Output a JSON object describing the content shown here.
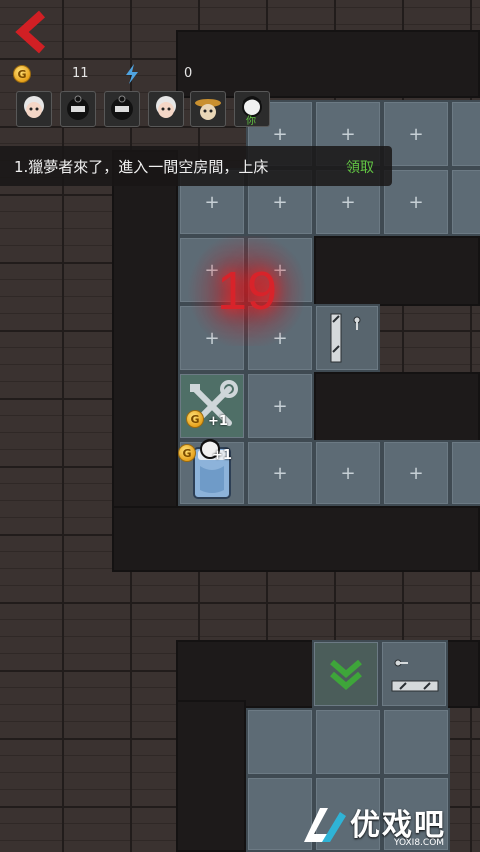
{
  "hud": {
    "back_icon": "chevron-left-icon",
    "coin_icon": "gold-coin-icon",
    "coin_letter": "G",
    "coins": "11",
    "energy_icon": "lightning-icon",
    "energy": "0",
    "accent_color": "#d11f24",
    "claim_color": "#62c443"
  },
  "hunters": [
    {
      "name": "hunter-granny-1",
      "icon": "granny-face-icon"
    },
    {
      "name": "hunter-masked-1",
      "icon": "masked-face-icon"
    },
    {
      "name": "hunter-masked-2",
      "icon": "masked-face-icon"
    },
    {
      "name": "hunter-granny-2",
      "icon": "granny-face-icon"
    },
    {
      "name": "hunter-straw-hat",
      "icon": "straw-hat-face-icon"
    },
    {
      "name": "hunter-you",
      "icon": "player-face-icon",
      "label": "你"
    }
  ],
  "quest": {
    "text": "1.獵夢者來了，進入一間空房間，上床",
    "claim": "領取"
  },
  "board": {
    "countdown": "19",
    "tile_mark": "+",
    "rewards": {
      "tool_plus": "+1",
      "bed_plus": "+1"
    }
  },
  "watermark": {
    "brand": "优戏吧",
    "url": "YOXI8.COM"
  }
}
